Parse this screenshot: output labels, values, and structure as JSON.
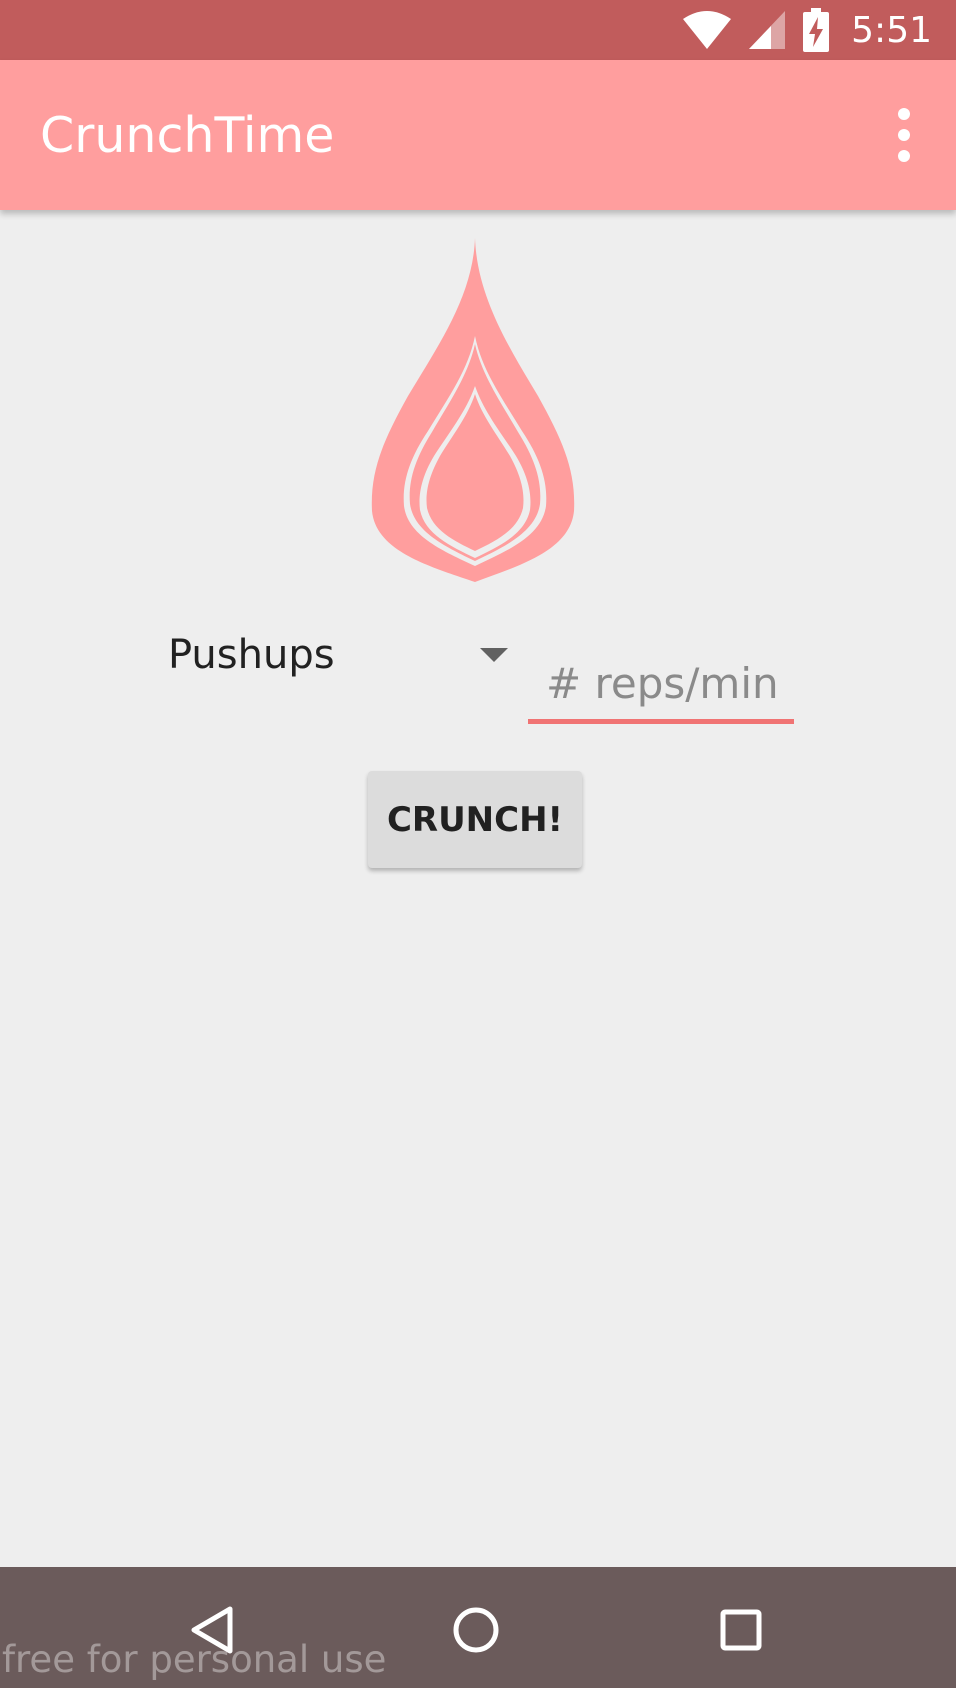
{
  "status_bar": {
    "time": "5:51",
    "icons": [
      "wifi-icon",
      "cellular-signal-icon",
      "battery-charging-icon"
    ],
    "background": "#c15c5c"
  },
  "app_bar": {
    "title": "CrunchTime",
    "menu_icon": "more-vert-icon",
    "background": "#ff9e9e"
  },
  "logo": {
    "icon": "flame-icon",
    "color": "#ff9e9e"
  },
  "exercise_spinner": {
    "selected": "Pushups"
  },
  "reps_input": {
    "value": "",
    "placeholder": "# reps/min",
    "underline_color": "#f07373"
  },
  "crunch_button": {
    "label": "CRUNCH!"
  },
  "nav_bar": {
    "buttons": [
      "back-icon",
      "home-icon",
      "recents-icon"
    ],
    "background": "#6b5b5b"
  },
  "watermark": "free for personal use"
}
